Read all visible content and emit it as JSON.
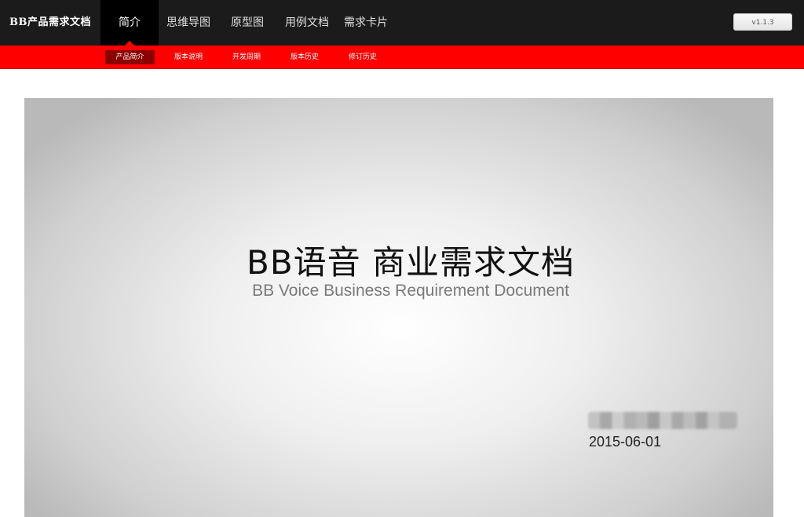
{
  "header": {
    "brand": "BB产品需求文档",
    "version_label": "v1.1.3",
    "nav": [
      {
        "label": "简介",
        "active": true
      },
      {
        "label": "思维导图",
        "active": false
      },
      {
        "label": "原型图",
        "active": false
      },
      {
        "label": "用例文档",
        "active": false
      },
      {
        "label": "需求卡片",
        "active": false
      }
    ]
  },
  "subnav": [
    {
      "label": "产品简介",
      "active": true
    },
    {
      "label": "版本说明",
      "active": false
    },
    {
      "label": "开发周期",
      "active": false
    },
    {
      "label": "版本历史",
      "active": false
    },
    {
      "label": "修订历史",
      "active": false
    }
  ],
  "slide": {
    "title": "BB语音  商业需求文档",
    "subtitle": "BB Voice Business Requirement Document",
    "date": "2015-06-01"
  },
  "colors": {
    "topbar": "#1b1b1b",
    "active_nav": "#000000",
    "accent_red": "#ff0000",
    "active_sub": "#8c0000"
  }
}
